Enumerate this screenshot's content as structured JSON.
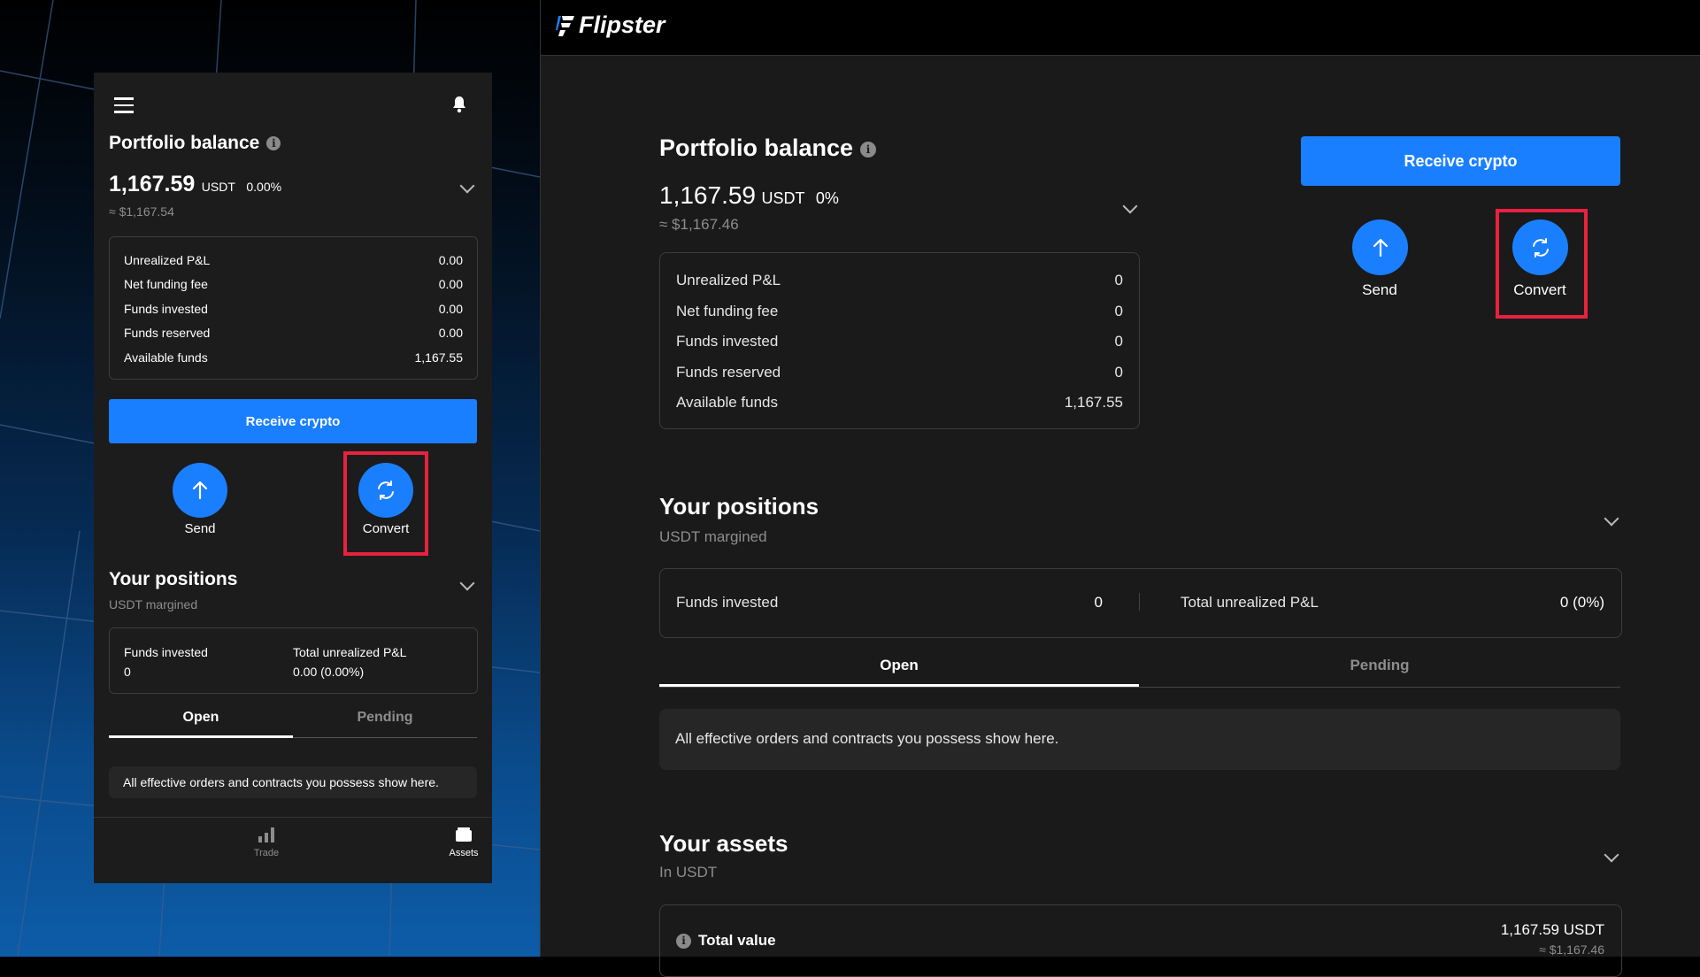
{
  "mobile": {
    "header": {
      "menu_icon": "hamburger-icon",
      "bell_icon": "bell-icon"
    },
    "portfolio": {
      "title": "Portfolio balance",
      "amount": "1,167.59",
      "currency": "USDT",
      "change": "0.00%",
      "fiat": "≈ $1,167.54",
      "rows": [
        {
          "label": "Unrealized P&L",
          "value": "0.00"
        },
        {
          "label": "Net funding fee",
          "value": "0.00"
        },
        {
          "label": "Funds invested",
          "value": "0.00"
        },
        {
          "label": "Funds reserved",
          "value": "0.00"
        },
        {
          "label": "Available funds",
          "value": "1,167.55"
        }
      ]
    },
    "receive_label": "Receive crypto",
    "send_label": "Send",
    "convert_label": "Convert",
    "positions": {
      "title": "Your positions",
      "subtitle": "USDT margined",
      "funds_invested_label": "Funds invested",
      "funds_invested_value": "0",
      "total_pnl_label": "Total unrealized P&L",
      "total_pnl_value": "0.00 (0.00%)",
      "tabs": [
        "Open",
        "Pending"
      ],
      "empty_text": "All effective orders and contracts you possess show here."
    },
    "bottom_nav": [
      {
        "label": "Trade",
        "icon": "chart-bars-icon"
      },
      {
        "label": "Assets",
        "icon": "wallet-icon"
      }
    ]
  },
  "desktop": {
    "brand": "Flipster",
    "portfolio": {
      "title": "Portfolio balance",
      "amount": "1,167.59",
      "currency": "USDT",
      "change": "0%",
      "fiat": "≈ $1,167.46",
      "rows": [
        {
          "label": "Unrealized P&L",
          "value": "0"
        },
        {
          "label": "Net funding fee",
          "value": "0"
        },
        {
          "label": "Funds invested",
          "value": "0"
        },
        {
          "label": "Funds reserved",
          "value": "0"
        },
        {
          "label": "Available funds",
          "value": "1,167.55"
        }
      ]
    },
    "receive_label": "Receive crypto",
    "send_label": "Send",
    "convert_label": "Convert",
    "positions": {
      "title": "Your positions",
      "subtitle": "USDT margined",
      "funds_invested_label": "Funds invested",
      "funds_invested_value": "0",
      "total_pnl_label": "Total unrealized P&L",
      "total_pnl_value": "0 (0%)",
      "tabs": [
        "Open",
        "Pending"
      ],
      "empty_text": "All effective orders and contracts you possess show here."
    },
    "assets": {
      "title": "Your assets",
      "subtitle": "In USDT",
      "total_label": "Total value",
      "total_value": "1,167.59 USDT",
      "total_fiat": "≈ $1,167.46"
    }
  },
  "colors": {
    "accent": "#1a7fff",
    "highlight": "#e8213f",
    "panel": "#1c1c1c"
  }
}
